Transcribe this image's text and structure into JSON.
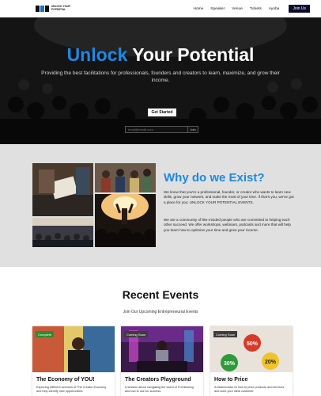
{
  "nav": {
    "logo_text": "UNLOCK YOUR POTENTIAL",
    "links": [
      "Home",
      "Speaker",
      "Venue",
      "Tickets",
      "Ayoba"
    ],
    "join_label": "Join Us"
  },
  "hero": {
    "title_accent": "Unlock",
    "title_rest": " Your Potential",
    "subtitle": "Providing the best facilitations for professionals, founders and creators to learn, maximize, and grow their income.",
    "cta_label": "Get Started",
    "email_placeholder": "email@email.com",
    "email_button": "Join"
  },
  "why": {
    "heading": "Why do we Exist?",
    "paragraph1": "We know that you're a professional, founder, or creator who wants to learn new skills, grow your network, and make the most of your time. If that's you, we've got a place for you: UNLOCK YOUR POTENTIAL EVENTS.",
    "paragraph2": "We are a community of like-minded people who are committed to helping each other succeed. We offer workshops, webinars, podcasts and more that will help you learn how to optimize your time and grow your income."
  },
  "events": {
    "title": "Recent Events",
    "subtitle": "Join Our Upcoming Entrepreneurial Events",
    "cards": [
      {
        "badge": "Complete",
        "title": "The Economy of YOU!",
        "desc": "Exploring different avenues of The Creator Economy and help identify new opportunities"
      },
      {
        "badge": "Coming Soon",
        "title": "The Creators Playground",
        "desc": "A session about navigating the world of Freelancing and tool to use for success."
      },
      {
        "badge": "Coming Soon",
        "title": "How to Price",
        "desc": "A Masterclass on how to price products and services and work your ideal customer."
      }
    ],
    "price_tags": [
      "50%",
      "30%",
      "20%"
    ]
  },
  "colors": {
    "accent": "#1e88e5",
    "badge_complete": "#2e8b2e",
    "join_bg": "#0a0a2a"
  }
}
